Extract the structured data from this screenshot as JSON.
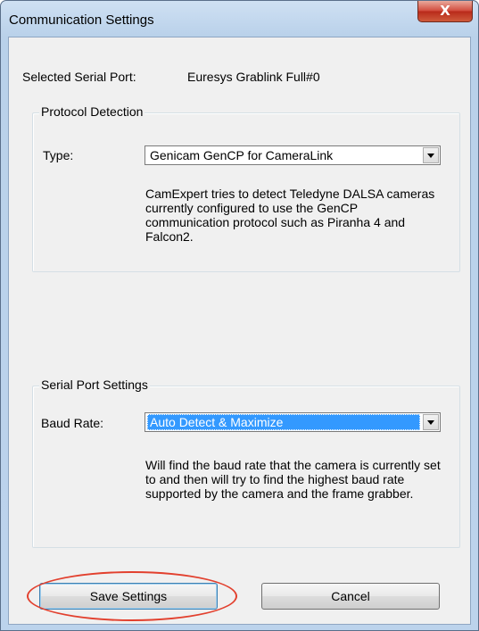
{
  "window": {
    "title": "Communication Settings",
    "close_label": "X"
  },
  "serial_port": {
    "label": "Selected Serial Port:",
    "value": "Euresys Grablink Full#0"
  },
  "protocol_detection": {
    "group_label": "Protocol Detection",
    "type_label": "Type:",
    "type_value": "Genicam GenCP for CameraLink",
    "description": "CamExpert tries to detect Teledyne DALSA cameras currently configured to use the GenCP communication protocol such as Piranha 4 and Falcon2."
  },
  "serial_port_settings": {
    "group_label": "Serial Port Settings",
    "baud_label": "Baud Rate:",
    "baud_value": "Auto Detect & Maximize",
    "description": "Will find the baud rate that the camera is currently set to and then will try to find the highest baud rate supported by the camera and the frame grabber."
  },
  "buttons": {
    "save_label": "Save Settings",
    "cancel_label": "Cancel"
  },
  "colors": {
    "highlight": "#e2402e",
    "selection": "#3399ff"
  }
}
